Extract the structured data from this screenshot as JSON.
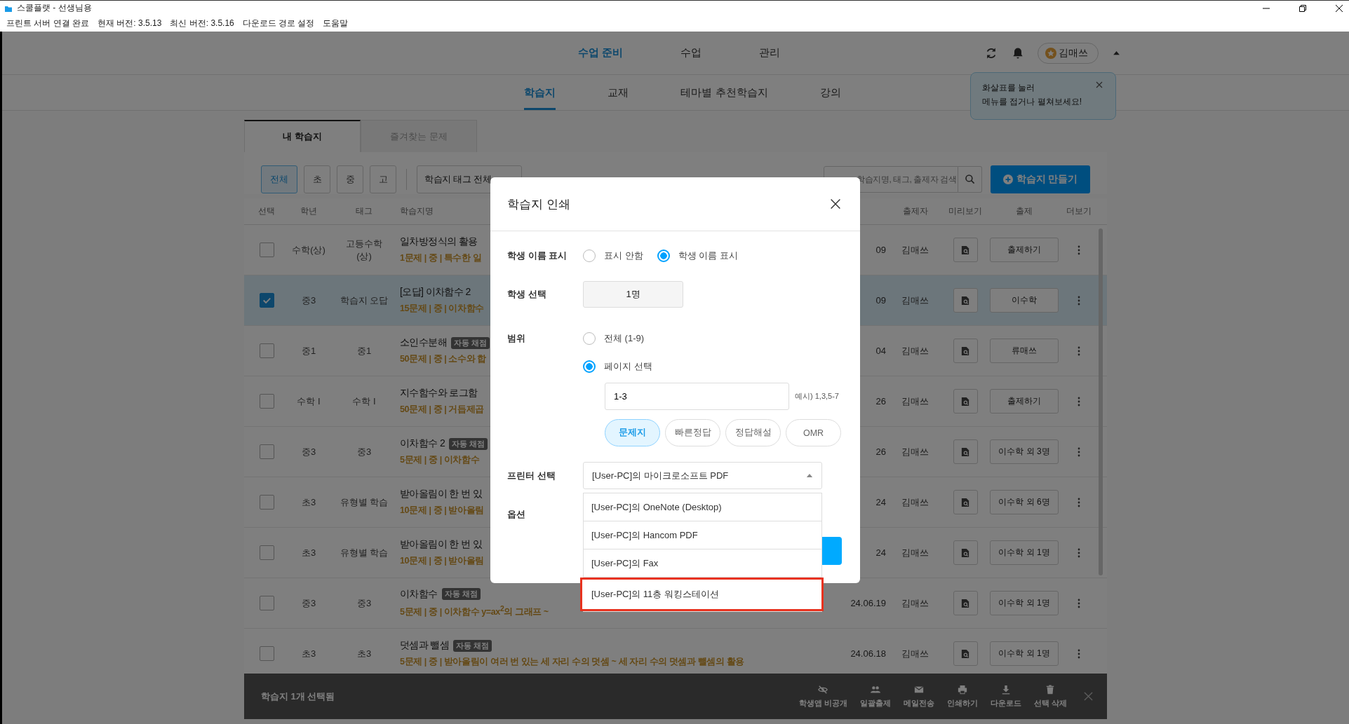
{
  "window": {
    "title": "스쿨플랫 - 선생님용"
  },
  "menu_bar": [
    "프린트 서버 연결 완료",
    "현재 버전: 3.5.13",
    "최신 버전: 3.5.16",
    "다운로드 경로 설정",
    "도움말"
  ],
  "top_nav": [
    {
      "label": "수업 준비",
      "selected": true
    },
    {
      "label": "수업",
      "selected": false
    },
    {
      "label": "관리",
      "selected": false
    }
  ],
  "user": {
    "name": "김매쓰"
  },
  "sub_nav": [
    {
      "label": "학습지",
      "selected": true
    },
    {
      "label": "교재",
      "selected": false
    },
    {
      "label": "테마별 추천학습지",
      "selected": false
    },
    {
      "label": "강의",
      "selected": false
    }
  ],
  "tooltip": {
    "lines": [
      "화살표를 눌러",
      "메뉴를 접거나 펼쳐보세요!"
    ]
  },
  "content_tabs": [
    {
      "label": "내 학습지",
      "selected": true
    },
    {
      "label": "즐겨찾는 문제",
      "selected": false
    }
  ],
  "grade_filters": [
    {
      "label": "전체",
      "selected": true
    },
    {
      "label": "초",
      "selected": false
    },
    {
      "label": "중",
      "selected": false
    },
    {
      "label": "고",
      "selected": false
    }
  ],
  "tag_filter": {
    "label": "학습지 태그 전체"
  },
  "search": {
    "placeholder": "학습지명, 태그, 출제자 검색"
  },
  "create_button": {
    "label": "학습지 만들기"
  },
  "columns": [
    "선택",
    "학년",
    "태그",
    "학습지명",
    "출제자",
    "미리보기",
    "출제",
    "더보기"
  ],
  "rows": [
    {
      "checked": false,
      "grade": "수학(상)",
      "tag": "고등수학\n(상)",
      "title": "일차방정식의 활용",
      "detail": "1문제 | 중 | 특수한 일",
      "date": "09",
      "author": "김매쓰",
      "assign": "출제하기"
    },
    {
      "checked": true,
      "grade": "중3",
      "tag": "학습지 오답",
      "title": "[오답] 이차함수 2",
      "detail": "15문제 | 중 | 이차함수",
      "date": "09",
      "author": "김매쓰",
      "assign": "이수학"
    },
    {
      "checked": false,
      "grade": "중1",
      "tag": "중1",
      "title": "소인수분해",
      "badge": "자동 채점",
      "detail": "50문제 | 중 | 소수와 합",
      "date": "04",
      "author": "김매쓰",
      "assign": "류매쓰"
    },
    {
      "checked": false,
      "grade": "수학 I",
      "tag": "수학 I",
      "title": "지수함수와 로그함",
      "detail": "50문제 | 중 | 거듭제곱",
      "date": "26",
      "author": "김매쓰",
      "assign": "출제하기"
    },
    {
      "checked": false,
      "grade": "중3",
      "tag": "중3",
      "title": "이차함수 2",
      "badge": "자동 채점",
      "detail": "5문제 | 중 | 이차함수",
      "date": "26",
      "author": "김매쓰",
      "assign": "이수학 외 3명"
    },
    {
      "checked": false,
      "grade": "초3",
      "tag": "유형별 학습",
      "title": "받아올림이 한 번 있",
      "detail": "10문제 | 중 | 받아올림",
      "date": "24",
      "author": "김매쓰",
      "assign": "이수학 외 6명"
    },
    {
      "checked": false,
      "grade": "초3",
      "tag": "유형별 학습",
      "title": "받아올림이 한 번 있",
      "detail": "10문제 | 중 | 받아올림",
      "date": "24",
      "author": "김매쓰",
      "assign": "이수학 외 1명"
    },
    {
      "checked": false,
      "grade": "중3",
      "tag": "중3",
      "title": "이차함수",
      "badge": "자동 채점",
      "detail": "5문제 | 중 | 이차함수 y=ax$^{2}$의 그래프 ~",
      "date": "24.06.19",
      "author": "김매쓰",
      "assign": "이수학 외 1명"
    },
    {
      "checked": false,
      "grade": "초3",
      "tag": "초3",
      "title": "덧셈과 뺄셈",
      "badge": "자동 채점",
      "detail": "5문제 | 중 | 받아올림이 여러 번 있는 세 자리 수의 덧셈 ~ 세 자리 수의 덧셈과 뺄셈의 활용",
      "date": "24.06.18",
      "author": "김매쓰",
      "assign": "이수학 외 1명"
    }
  ],
  "selection_bar": {
    "summary": "학습지 1개 선택됨",
    "actions": [
      {
        "kind": "hide",
        "label": "학생앱 비공개"
      },
      {
        "kind": "assign",
        "label": "일괄출제"
      },
      {
        "kind": "mail",
        "label": "메일전송"
      },
      {
        "kind": "print",
        "label": "인쇄하기"
      },
      {
        "kind": "download",
        "label": "다운로드"
      },
      {
        "kind": "delete",
        "label": "선택 삭제"
      }
    ]
  },
  "modal": {
    "title": "학습지 인쇄",
    "name_display": {
      "label": "학생 이름 표시",
      "options": [
        {
          "label": "표시 안함",
          "selected": false
        },
        {
          "label": "학생 이름 표시",
          "selected": true
        }
      ]
    },
    "student": {
      "label": "학생 선택",
      "value": "1명"
    },
    "range": {
      "label": "범위",
      "options": [
        {
          "label": "전체 (1-9)",
          "selected": false
        },
        {
          "label": "페이지 선택",
          "selected": true
        }
      ],
      "pages": "1-3",
      "hint": "예시) 1,3,5-7"
    },
    "doc_types": [
      {
        "label": "문제지",
        "selected": true
      },
      {
        "label": "빠른정답",
        "selected": false
      },
      {
        "label": "정답해설",
        "selected": false
      },
      {
        "label": "OMR",
        "selected": false
      }
    ],
    "printer": {
      "label": "프린터 선택",
      "value": "[User-PC]의 마이크로소프트 PDF",
      "expanded": true,
      "options": [
        {
          "label": "[User-PC]의 OneNote (Desktop)",
          "highlighted": false
        },
        {
          "label": "[User-PC]의 Hancom PDF",
          "highlighted": false
        },
        {
          "label": "[User-PC]의 Fax",
          "highlighted": false
        },
        {
          "label": "[User-PC]의 11층 워킹스테이션",
          "highlighted": true
        }
      ]
    },
    "options_label": "옵션"
  }
}
